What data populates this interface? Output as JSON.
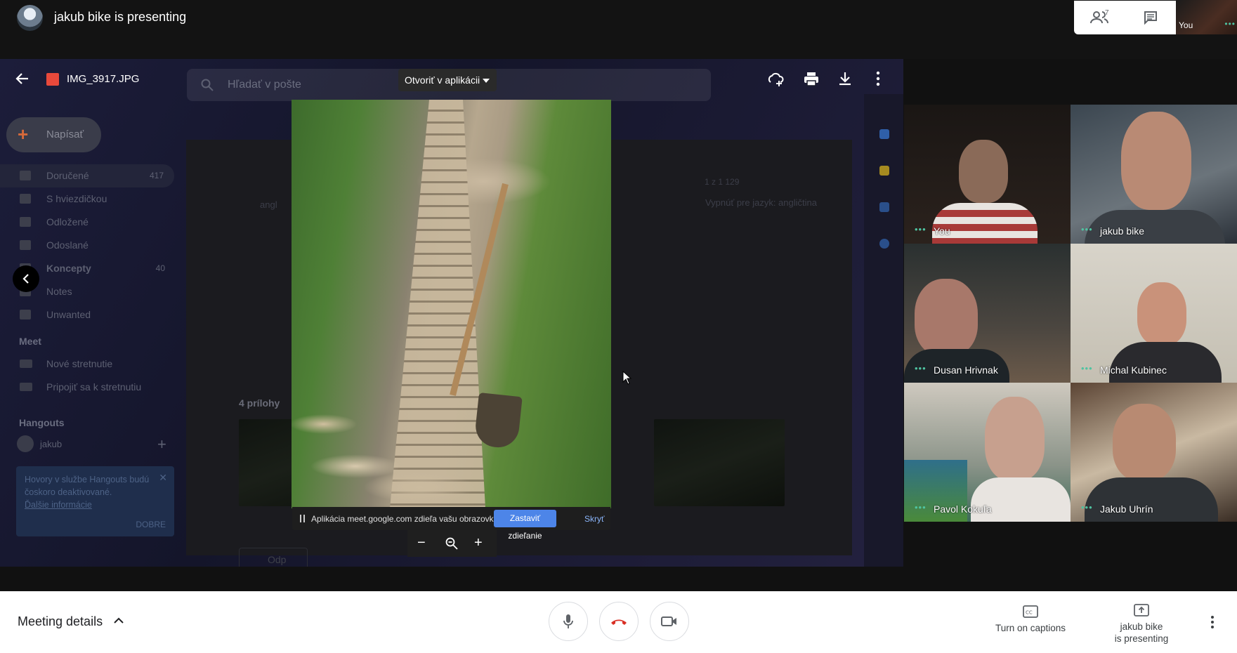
{
  "header": {
    "presenter_title": "jakub bike is presenting",
    "participants_count": "7",
    "self_label": "You"
  },
  "viewer": {
    "file_name": "IMG_3917.JPG",
    "open_with_label": "Otvoriť v aplikácii",
    "share_message": "Aplikácia meet.google.com zdieľa vašu obrazovku.",
    "stop_sharing_label": "Zastaviť zdieľanie",
    "hide_label": "Skryť"
  },
  "gmail": {
    "search_placeholder": "Hľadať v pošte",
    "compose_label": "Napísať",
    "nav": [
      {
        "label": "Doručené",
        "count": "417"
      },
      {
        "label": "S hviezdičkou",
        "count": ""
      },
      {
        "label": "Odložené",
        "count": ""
      },
      {
        "label": "Odoslané",
        "count": ""
      },
      {
        "label": "Koncepty",
        "count": "40"
      },
      {
        "label": "Notes",
        "count": ""
      },
      {
        "label": "Unwanted",
        "count": ""
      }
    ],
    "meet_heading": "Meet",
    "meet_new": "Nové stretnutie",
    "meet_join": "Pripojiť sa k stretnutiu",
    "hangouts_heading": "Hangouts",
    "hangouts_user": "jakub",
    "hangouts_notice": "Hovory v službe Hangouts budú čoskoro deaktivované.",
    "hangouts_link": "Ďalšie informácie",
    "hangouts_ok": "DOBRE",
    "translate_off": "Vypnúť pre jazyk: angličtina",
    "translate_from": "angl",
    "attachments_heading": "4 prílohy",
    "reply_label": "Odp",
    "pager": "1 z 1 129"
  },
  "participants": [
    {
      "name": "You"
    },
    {
      "name": "jakub bike"
    },
    {
      "name": "Dusan Hrivnak"
    },
    {
      "name": "Michal Kubinec"
    },
    {
      "name": "Pavol Kokuľa"
    },
    {
      "name": "Jakub Uhrín"
    }
  ],
  "bottom": {
    "meeting_details": "Meeting details",
    "captions_label": "Turn on captions",
    "presenting_line1": "jakub bike",
    "presenting_line2": "is presenting"
  },
  "colors": {
    "accent_green": "#4fc3a1",
    "end_call_red": "#d93025",
    "stop_share_blue": "#4d85e8"
  }
}
